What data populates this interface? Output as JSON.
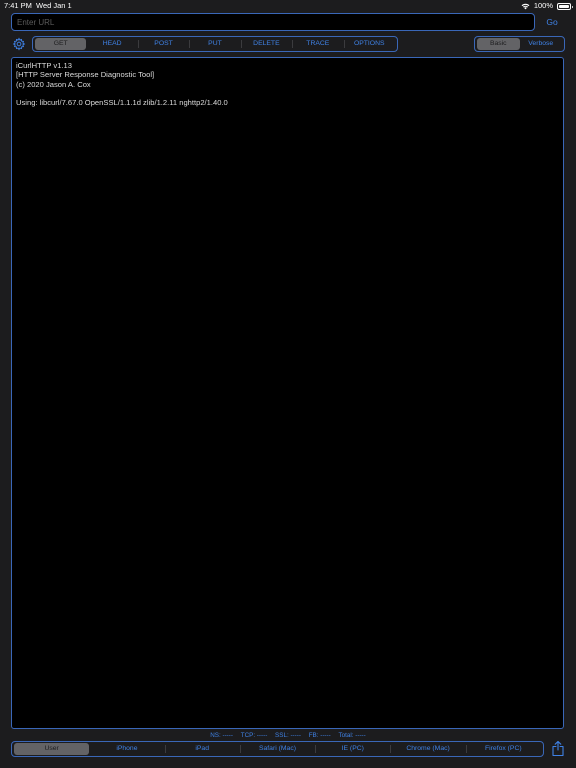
{
  "status_bar": {
    "time": "7:41 PM",
    "date": "Wed Jan 1",
    "battery": "100%"
  },
  "url_bar": {
    "placeholder": "Enter URL",
    "value": "",
    "go_label": "Go"
  },
  "methods": {
    "items": [
      "GET",
      "HEAD",
      "POST",
      "PUT",
      "DELETE",
      "TRACE",
      "OPTIONS"
    ],
    "selected": "GET"
  },
  "mode": {
    "items": [
      "Basic",
      "Verbose"
    ],
    "selected": "Basic"
  },
  "console": {
    "lines": [
      "iCurlHTTP v1.13",
      "[HTTP Server Response Diagnostic Tool]",
      "(c) 2020 Jason A. Cox",
      "",
      "Using: libcurl/7.67.0 OpenSSL/1.1.1d zlib/1.2.11 nghttp2/1.40.0"
    ]
  },
  "stats": {
    "ns": "NS: -----",
    "tcp": "TCP: -----",
    "ssl": "SSL: -----",
    "fb": "FB: -----",
    "total": "Total: -----"
  },
  "user_agents": {
    "items": [
      "User",
      "iPhone",
      "iPad",
      "Safari (Mac)",
      "IE (PC)",
      "Chrome (Mac)",
      "Firefox (PC)"
    ],
    "selected": "User"
  },
  "colors": {
    "accent": "#3f82e6",
    "border": "#3a67b8",
    "selected": "#636366",
    "background": "#1c1c1e"
  },
  "icons": {
    "settings": "gear-icon",
    "share": "share-icon",
    "wifi": "wifi-icon",
    "battery": "battery-icon"
  }
}
